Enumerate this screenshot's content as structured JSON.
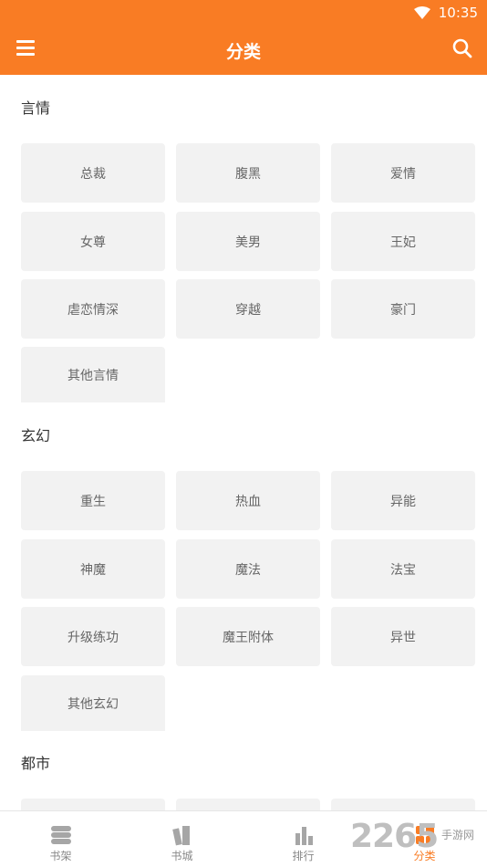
{
  "statusbar": {
    "time": "10:35"
  },
  "header": {
    "title": "分类"
  },
  "sections": [
    {
      "title": "言情",
      "tags": [
        "总裁",
        "腹黑",
        "爱情",
        "女尊",
        "美男",
        "王妃",
        "虐恋情深",
        "穿越",
        "豪门",
        "其他言情"
      ]
    },
    {
      "title": "玄幻",
      "tags": [
        "重生",
        "热血",
        "异能",
        "神魔",
        "魔法",
        "法宝",
        "升级练功",
        "魔王附体",
        "异世",
        "其他玄幻"
      ]
    },
    {
      "title": "都市",
      "tags": [
        "",
        "",
        ""
      ]
    }
  ],
  "bottom_nav": [
    {
      "label": "书架",
      "icon": "bookshelf-icon"
    },
    {
      "label": "书城",
      "icon": "bookstore-icon"
    },
    {
      "label": "排行",
      "icon": "ranking-icon"
    },
    {
      "label": "分类",
      "icon": "category-icon",
      "active": true
    }
  ],
  "watermark": {
    "number": "2265",
    "site": "手游网"
  },
  "colors": {
    "accent": "#f97c24",
    "tag_bg": "#f2f2f2"
  }
}
